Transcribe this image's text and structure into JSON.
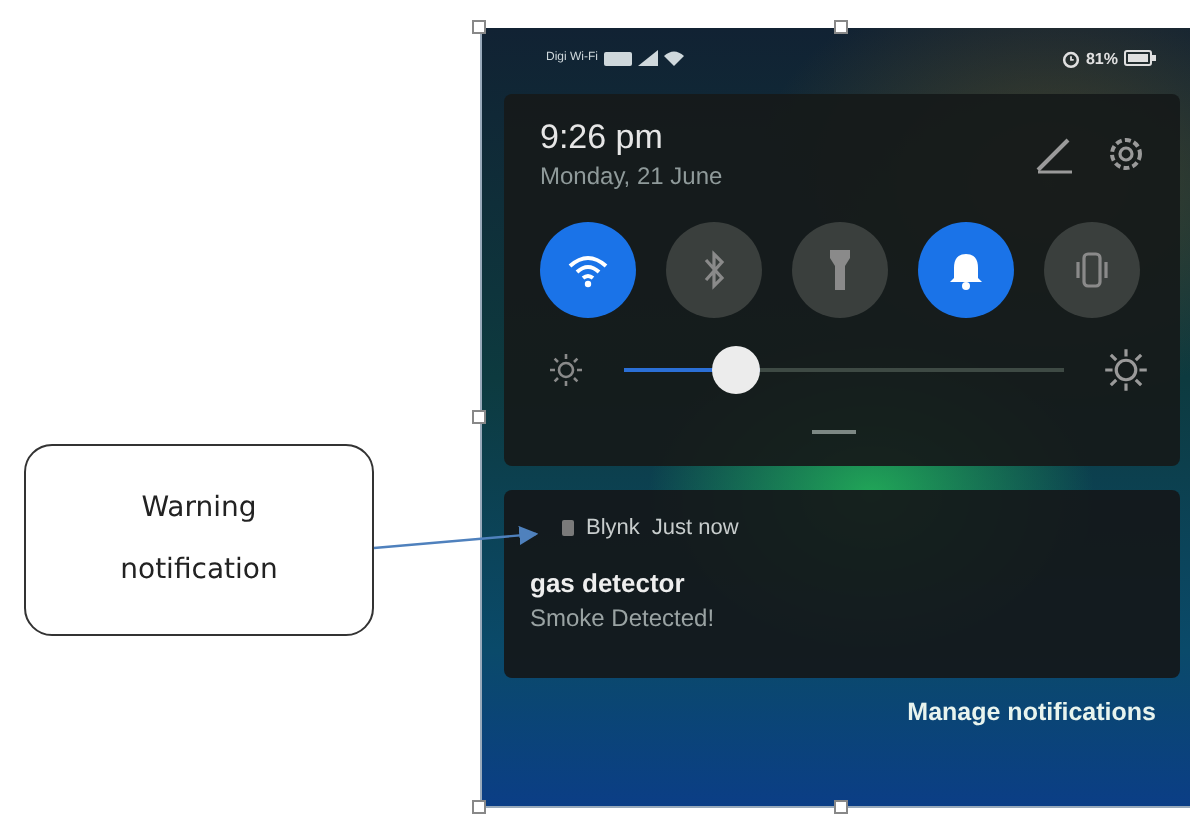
{
  "status_bar": {
    "carrier": "Digi Wi-Fi",
    "battery": "81%"
  },
  "quick_panel": {
    "time": "9:26 pm",
    "date": "Monday, 21 June",
    "toggles": [
      {
        "kind": "wifi",
        "on": true
      },
      {
        "kind": "bluetooth",
        "on": false
      },
      {
        "kind": "flashlight",
        "on": false
      },
      {
        "kind": "sound",
        "on": true
      },
      {
        "kind": "vibrate",
        "on": false
      }
    ],
    "brightness": {
      "level": 0.28
    }
  },
  "notifications": [
    {
      "app": "Blynk",
      "time": "Just now",
      "title": "gas detector",
      "body": "Smoke Detected!"
    }
  ],
  "manage_link": "Manage notifications",
  "callout": {
    "text": "Warning notification"
  }
}
